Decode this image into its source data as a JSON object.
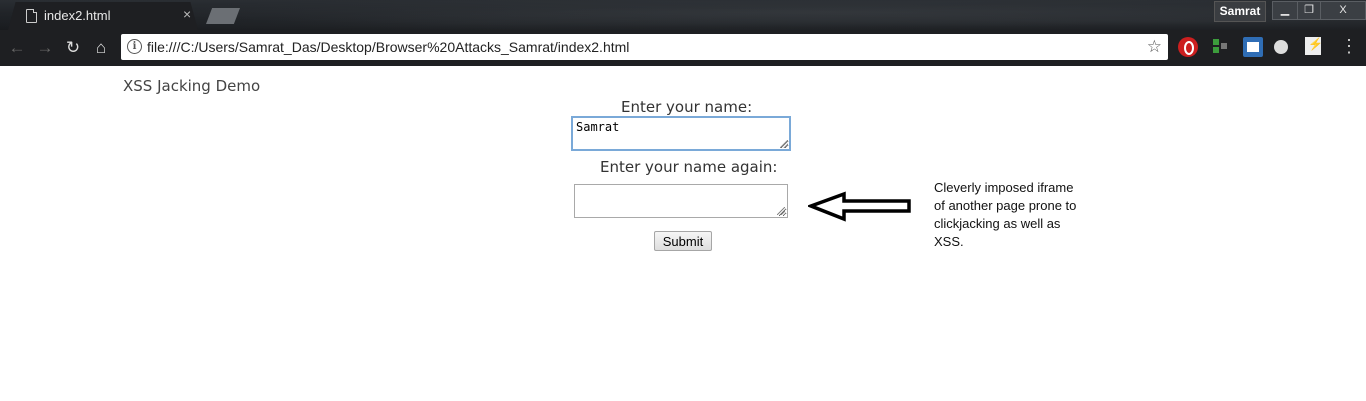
{
  "browser": {
    "tab_title": "index2.html",
    "tab_close": "×",
    "profile_name": "Samrat",
    "url": "file:///C:/Users/Samrat_Das/Desktop/Browser%20Attacks_Samrat/index2.html",
    "window_controls": {
      "minimize": "▁",
      "maximize": "❐",
      "close": "X"
    },
    "nav_icons": {
      "back": "←",
      "forward": "→",
      "reload": "↻",
      "home": "⌂",
      "info": "i",
      "star": "☆",
      "menu": "⋮"
    }
  },
  "page": {
    "title": "XSS Jacking Demo",
    "name_label": "Enter your name:",
    "name_value": "Samrat",
    "name_again_label": "Enter your name again:",
    "name_again_value": "",
    "submit_label": "Submit",
    "annotation": "Cleverly imposed iframe of another page prone to clickjacking as well as XSS."
  }
}
